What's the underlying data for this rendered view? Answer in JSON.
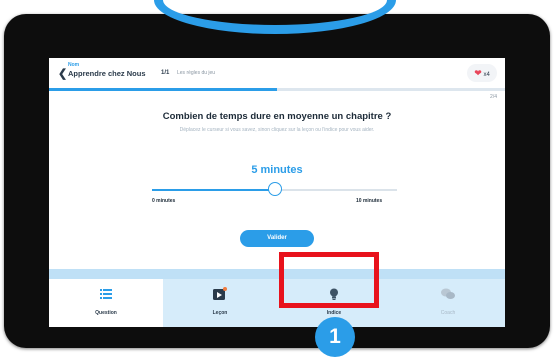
{
  "header": {
    "app_subtitle": "Nom",
    "app_title": "Apprendre chez Nous",
    "step": "1/1",
    "step_label": "Les règles du jeu",
    "lives": "x4",
    "progress_fraction": 0.5
  },
  "counter": "2/4",
  "question": {
    "title": "Combien de temps dure en moyenne un chapitre ?",
    "hint": "Déplacez le curseur si vous savez, sinon cliquez sur la leçon ou l'indice pour vous aider."
  },
  "slider": {
    "value_text": "5 minutes",
    "value": 5,
    "min": 0,
    "max": 10,
    "min_label": "0 minutes",
    "max_label": "10 minutes"
  },
  "submit_label": "Valider",
  "nav": [
    {
      "label": "Question",
      "icon": "list-icon"
    },
    {
      "label": "Leçon",
      "icon": "video-icon"
    },
    {
      "label": "Indice",
      "icon": "lightbulb-icon"
    },
    {
      "label": "Coach",
      "icon": "chat-icon"
    }
  ],
  "annotation_marker": "1",
  "colors": {
    "accent": "#2b9de8",
    "highlight": "#e8121c",
    "heart": "#e8455a",
    "nav_bg": "#d6ecfa"
  }
}
